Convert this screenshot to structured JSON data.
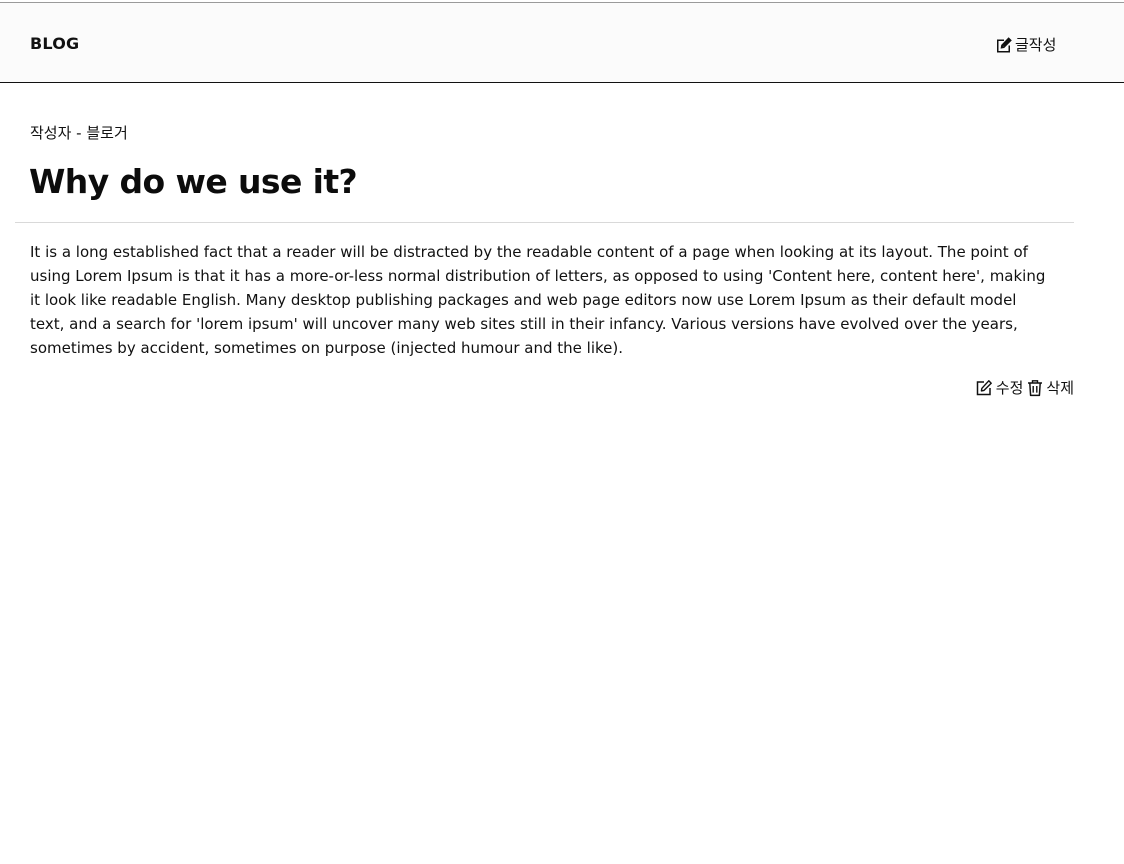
{
  "header": {
    "brand": "BLOG",
    "write_label": "글작성",
    "write_icon": "edit-square-icon"
  },
  "post": {
    "author_line": "작성자 - 블로거",
    "title": "Why do we use it?",
    "body": "It is a long established fact that a reader will be distracted by the readable content of a page when looking at its layout. The point of using Lorem Ipsum is that it has a more-or-less normal distribution of letters, as opposed to using 'Content here, content here', making it look like readable English. Many desktop publishing packages and web page editors now use Lorem Ipsum as their default model text, and a search for 'lorem ipsum' will uncover many web sites still in their infancy. Various versions have evolved over the years, sometimes by accident, sometimes on purpose (injected humour and the like)."
  },
  "actions": {
    "edit_label": "수정",
    "edit_icon": "pencil-square-icon",
    "delete_label": "삭제",
    "delete_icon": "trash-icon"
  }
}
